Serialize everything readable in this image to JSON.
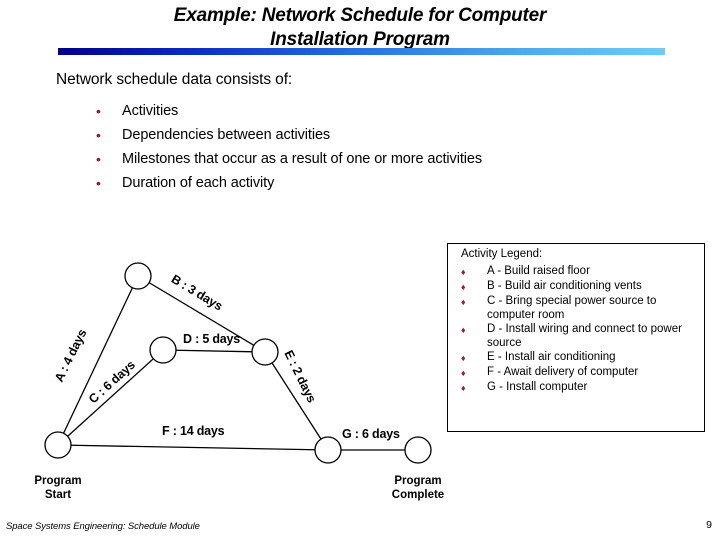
{
  "slide": {
    "title_line1": "Example: Network Schedule for Computer",
    "title_line2": "Installation Program",
    "intro": "Network schedule data consists of:",
    "accent_dark": "#000087",
    "accent_light": "#6fcdf2",
    "bullet_color": "#9e1b32"
  },
  "bullets": [
    {
      "marker": "•",
      "text": "Activities"
    },
    {
      "marker": "•",
      "text": "Dependencies between activities"
    },
    {
      "marker": "•",
      "text": "Milestones that occur as a result of one or more activities"
    },
    {
      "marker": "•",
      "text": "Duration of each activity"
    }
  ],
  "legend": {
    "title": "Activity Legend:",
    "marker": "♦",
    "items": [
      {
        "text": "A - Build raised floor"
      },
      {
        "text": "B - Build air conditioning vents"
      },
      {
        "text": "C - Bring special power source to computer room"
      },
      {
        "text": "D - Install wiring and connect to power source"
      },
      {
        "text": "E - Install air conditioning"
      },
      {
        "text": "F - Await delivery of computer"
      },
      {
        "text": "G - Install computer"
      }
    ]
  },
  "network": {
    "edges": [
      {
        "id": "A",
        "label": "A : 4 days",
        "duration_days": 4
      },
      {
        "id": "B",
        "label": "B : 3 days",
        "duration_days": 3
      },
      {
        "id": "C",
        "label": "C : 6 days",
        "duration_days": 6
      },
      {
        "id": "D",
        "label": "D : 5 days",
        "duration_days": 5
      },
      {
        "id": "E",
        "label": "E : 2 days",
        "duration_days": 2
      },
      {
        "id": "F",
        "label": "F : 14 days",
        "duration_days": 14
      },
      {
        "id": "G",
        "label": "G : 6 days",
        "duration_days": 6
      }
    ],
    "milestone_start": "Program\nStart",
    "milestone_start_line1": "Program",
    "milestone_start_line2": "Start",
    "milestone_complete_line1": "Program",
    "milestone_complete_line2": "Complete"
  },
  "footer": {
    "text": "Space Systems Engineering: Schedule Module",
    "page": "9"
  }
}
